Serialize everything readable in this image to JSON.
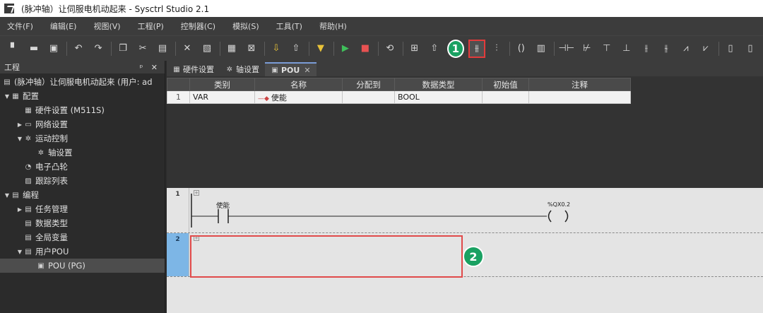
{
  "window": {
    "title": "(脉冲轴）让伺服电机动起来 - Sysctrl Studio 2.1"
  },
  "menu": [
    "文件(F)",
    "编辑(E)",
    "视图(V)",
    "工程(P)",
    "控制器(C)",
    "模拟(S)",
    "工具(T)",
    "帮助(H)"
  ],
  "toolbar": {
    "step_badge": "1"
  },
  "project_panel": {
    "title": "工程",
    "controls": "ᵖ ✕",
    "root": "(脉冲轴）让伺服电机动起来 (用户: ad",
    "items": [
      {
        "label": "配置",
        "level": 0,
        "caret": "▼"
      },
      {
        "label": "硬件设置 (M511S)",
        "level": 1,
        "caret": ""
      },
      {
        "label": "网络设置",
        "level": 1,
        "caret": "▶"
      },
      {
        "label": "运动控制",
        "level": 1,
        "caret": "▼"
      },
      {
        "label": "轴设置",
        "level": 2,
        "caret": ""
      },
      {
        "label": "电子凸轮",
        "level": 1,
        "caret": ""
      },
      {
        "label": "跟踪列表",
        "level": 1,
        "caret": ""
      },
      {
        "label": "编程",
        "level": 0,
        "caret": "▼"
      },
      {
        "label": "任务管理",
        "level": 1,
        "caret": "▶"
      },
      {
        "label": "数据类型",
        "level": 1,
        "caret": ""
      },
      {
        "label": "全局变量",
        "level": 1,
        "caret": ""
      },
      {
        "label": "用户POU",
        "level": 1,
        "caret": "▼"
      },
      {
        "label": "POU (PG)",
        "level": 2,
        "caret": ""
      }
    ]
  },
  "tabs": [
    {
      "label": "硬件设置",
      "active": false
    },
    {
      "label": "轴设置",
      "active": false
    },
    {
      "label": "POU",
      "active": true
    }
  ],
  "variables": {
    "headers": [
      "类别",
      "名称",
      "分配到",
      "数据类型",
      "初始值",
      "注释"
    ],
    "rows": [
      {
        "num": "1",
        "category": "VAR",
        "name": "使能",
        "assign": "",
        "type": "BOOL",
        "init": "",
        "comment": ""
      }
    ]
  },
  "ladder": {
    "rung1": {
      "number": "1",
      "contact_label": "使能",
      "coil_label": "%QX0.2"
    },
    "rung2": {
      "number": "2"
    }
  },
  "annotation": {
    "badge2": "2"
  },
  "colors": {
    "highlight": "#e23b3b",
    "badge": "#1aa162",
    "rung_active": "#7db6e6"
  }
}
